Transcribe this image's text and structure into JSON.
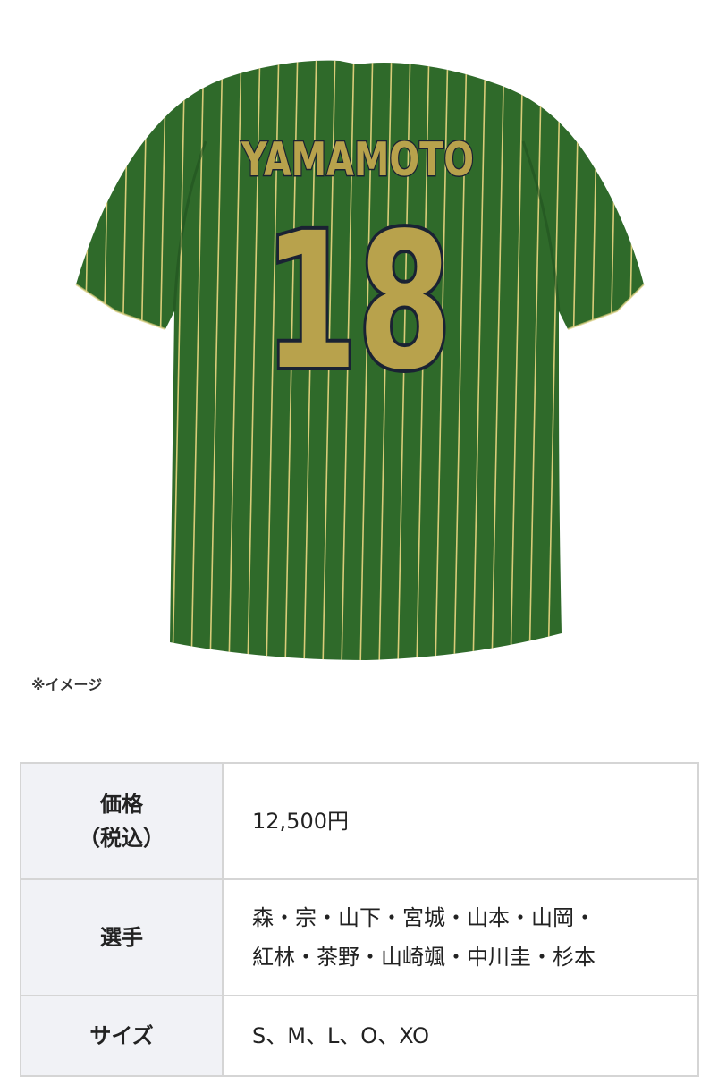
{
  "image": {
    "name_print": "YAMAMOTO",
    "number_print": "18",
    "note": "※イメージ",
    "colors": {
      "jersey_green": "#2f6a2a",
      "jersey_dark": "#22511f",
      "stripe_gold": "#d9cc79",
      "letter_gold": "#b8a24c",
      "letter_outline": "#1a2233"
    }
  },
  "specs": {
    "price": {
      "label_line1": "価格",
      "label_line2": "（税込）",
      "value": "12,500円"
    },
    "players": {
      "label": "選手",
      "value_line1": "森・宗・山下・宮城・山本・山岡・",
      "value_line2": "紅林・茶野・山崎颯・中川圭・杉本"
    },
    "size": {
      "label": "サイズ",
      "value": "S、M、L、O、XO"
    }
  }
}
